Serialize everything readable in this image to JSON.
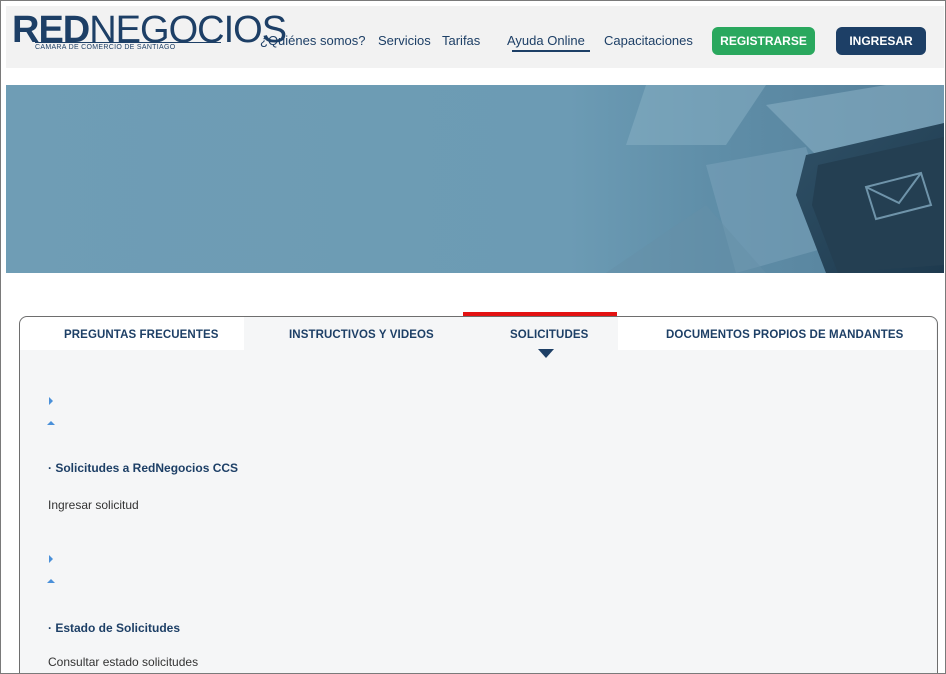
{
  "logo": {
    "brand_bold": "RED",
    "brand_light": "NEGOCIOS",
    "tagline": "CAMARA DE COMERCIO DE SANTIAGO"
  },
  "nav": {
    "items": [
      "¿Quiénes somos?",
      "Servicios",
      "Tarifas",
      "Ayuda Online",
      "Capacitaciones"
    ],
    "active": "Ayuda Online",
    "register_label": "REGISTRARSE",
    "login_label": "INGRESAR"
  },
  "tabs": {
    "items": [
      "PREGUNTAS FRECUENTES",
      "INSTRUCTIVOS Y VIDEOS",
      "SOLICITUDES",
      "DOCUMENTOS PROPIOS DE MANDANTES"
    ],
    "active": "SOLICITUDES"
  },
  "sections": [
    {
      "title": "· Solicitudes a RedNegocios CCS",
      "link": "Ingresar solicitud"
    },
    {
      "title": "· Estado de Solicitudes",
      "link": "Consultar estado solicitudes"
    }
  ],
  "colors": {
    "brand_navy": "#1d3f66",
    "register_green": "#2aa85e",
    "highlight_red": "#e31212",
    "hero_blue": "#6f9db5"
  },
  "icons": {
    "hero": "envelope-key-icon"
  }
}
